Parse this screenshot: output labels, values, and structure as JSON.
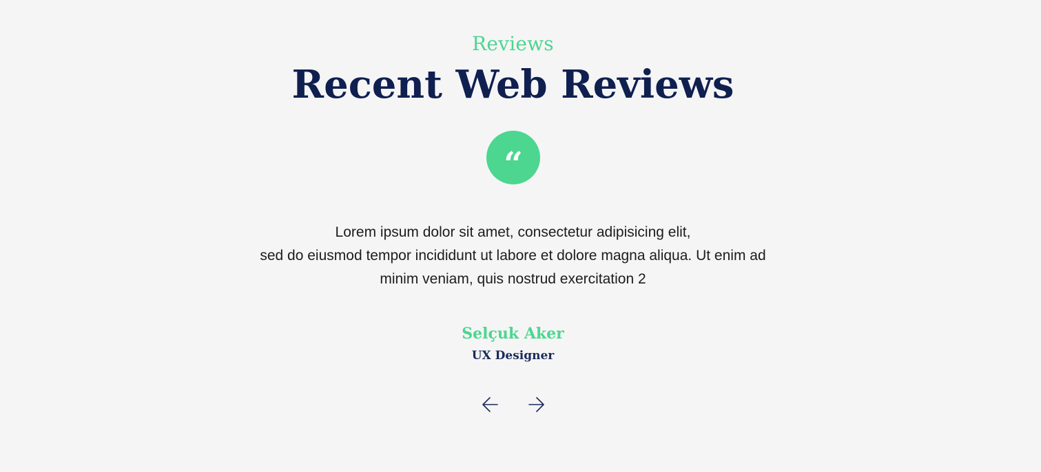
{
  "section": {
    "kicker": "Reviews",
    "title": "Recent Web Reviews"
  },
  "quote_badge": {
    "glyph": "“",
    "icon": "quote-icon",
    "color": "#4cd68f"
  },
  "review": {
    "lines": [
      "Lorem ipsum dolor sit amet, consectetur adipisicing elit,",
      "sed do eiusmod tempor incididunt ut labore et dolore magna aliqua. Ut enim ad",
      "minim veniam, quis nostrud exercitation 2"
    ],
    "author": {
      "name": "Selçuk Aker",
      "role": "UX Designer"
    }
  },
  "navigation": {
    "prev_icon": "arrow-left-icon",
    "next_icon": "arrow-right-icon"
  },
  "colors": {
    "background": "#f5f5f6",
    "accent": "#4cd68f",
    "heading": "#0f1f4f",
    "text": "#1c1c1c"
  }
}
